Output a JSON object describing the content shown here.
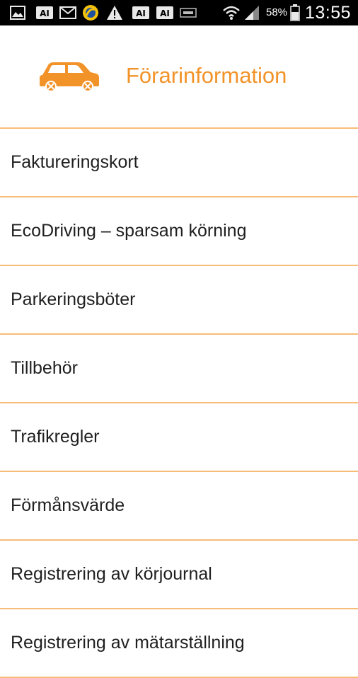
{
  "status_bar": {
    "icons": [
      "image-icon",
      "notification-icon",
      "mail-icon",
      "app-icon",
      "warning-icon",
      "notification-icon",
      "notification-icon",
      "nfc-icon",
      "wifi-icon",
      "signal-icon",
      "battery-icon"
    ],
    "battery_percent": "58%",
    "time": "13:55"
  },
  "header": {
    "icon": "car-icon",
    "title": "Förarinformation"
  },
  "menu": {
    "items": [
      {
        "label": "Faktureringskort"
      },
      {
        "label": "EcoDriving – sparsam körning"
      },
      {
        "label": "Parkeringsböter"
      },
      {
        "label": "Tillbehör"
      },
      {
        "label": "Trafikregler"
      },
      {
        "label": "Förmånsvärde"
      },
      {
        "label": "Registrering av körjournal"
      },
      {
        "label": "Registrering av mätarställning"
      }
    ]
  },
  "colors": {
    "accent": "#f2932a",
    "divider": "#f7bc77",
    "text": "#1f1f1f",
    "status_bar": "#000000"
  }
}
